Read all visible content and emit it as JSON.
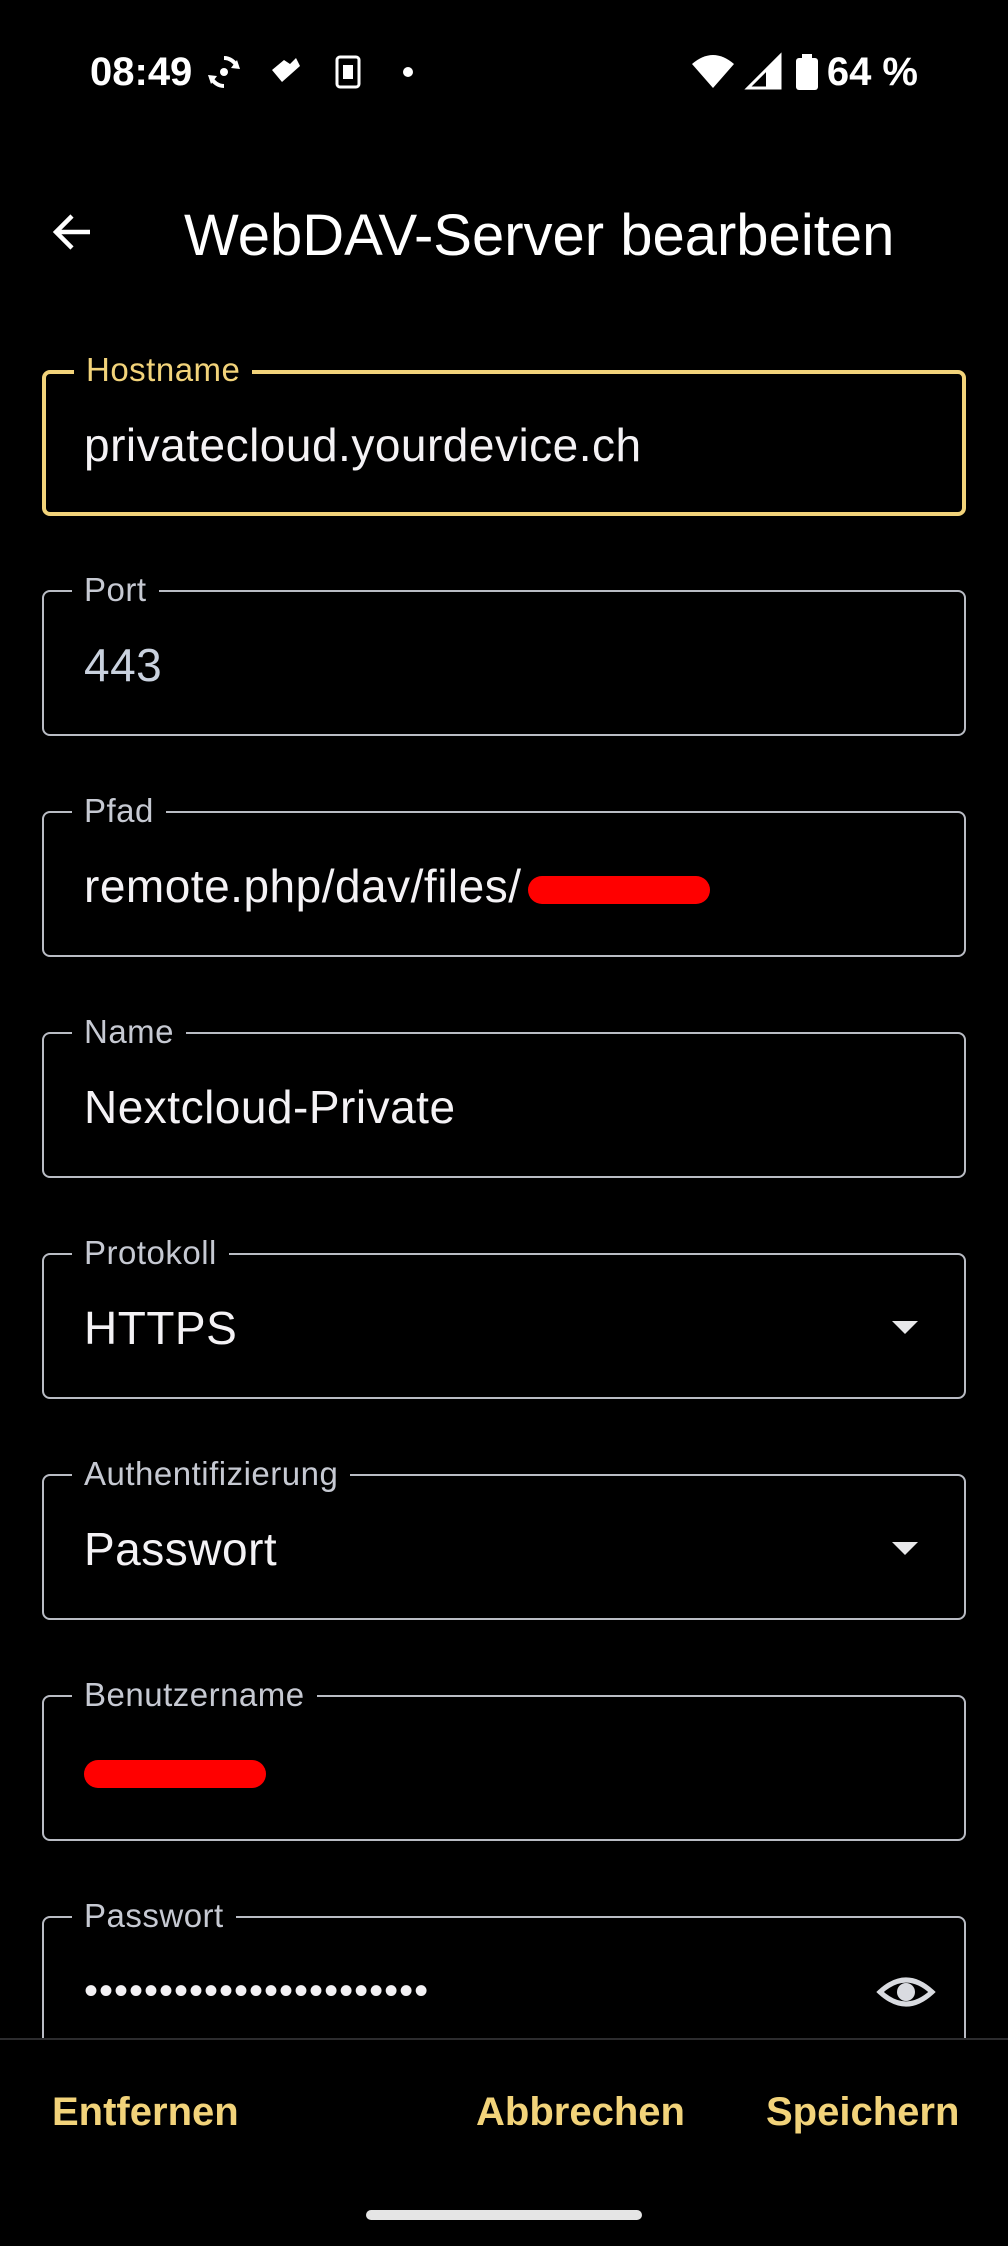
{
  "status_bar": {
    "time": "08:49",
    "battery": "64 %",
    "icons": [
      "sync-icon",
      "heart-hand-icon",
      "sim-card-icon",
      "notification-dot-icon",
      "wifi-icon",
      "signal-icon",
      "battery-icon"
    ]
  },
  "app_bar": {
    "back_icon": "arrow-left-icon",
    "title": "WebDAV-Server bearbeiten"
  },
  "form": {
    "hostname": {
      "label": "Hostname",
      "value": "privatecloud.yourdevice.ch"
    },
    "port": {
      "label": "Port",
      "value": "443"
    },
    "path": {
      "label": "Pfad",
      "value": "remote.php/dav/files/"
    },
    "name": {
      "label": "Name",
      "value": "Nextcloud-Private"
    },
    "protocol": {
      "label": "Protokoll",
      "value": "HTTPS"
    },
    "auth": {
      "label": "Authentifizierung",
      "value": "Passwort"
    },
    "username": {
      "label": "Benutzername"
    },
    "password": {
      "label": "Passwort",
      "value": "•••••••••••••••••••••••"
    }
  },
  "actions": {
    "remove": "Entfernen",
    "cancel": "Abbrechen",
    "save": "Speichern"
  },
  "colors": {
    "accent": "#f2d37a",
    "redaction": "#ff0000",
    "background": "#000000"
  }
}
